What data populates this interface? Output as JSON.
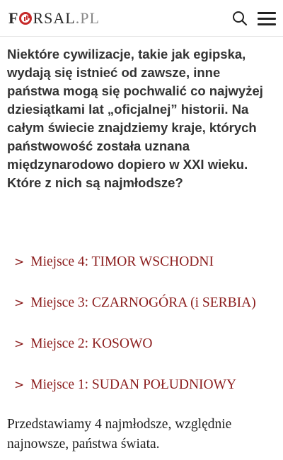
{
  "header": {
    "logo_f": "F",
    "logo_rsal": "RSAL",
    "logo_pl": ".PL",
    "search_icon": "search-icon",
    "menu_icon": "hamburger-menu-icon",
    "accent_color": "#c62828"
  },
  "article": {
    "lead": "Niektóre cywilizacje, takie jak egipska, wydają się istnieć od zawsze, inne państwa mogą się pochwalić co najwyżej dziesiątkami lat „oficjalnej” historii. Na całym świecie znajdziemy kraje, których państwowość została uznana międzynarodowo dopiero w XXI wieku. Które z nich są najmłodsze?",
    "toc": [
      {
        "chevron": ">",
        "label": "Miejsce 4: TIMOR WSCHODNI"
      },
      {
        "chevron": ">",
        "label": "Miejsce 3: CZARNOGÓRA (i SERBIA)"
      },
      {
        "chevron": ">",
        "label": "Miejsce 2: KOSOWO"
      },
      {
        "chevron": ">",
        "label": "Miejsce 1: SUDAN POŁUDNIOWY"
      }
    ],
    "link_color": "#8b1c1c",
    "body": "Przedstawiamy 4 najmłodsze, względnie najnowsze, państwa świata."
  }
}
